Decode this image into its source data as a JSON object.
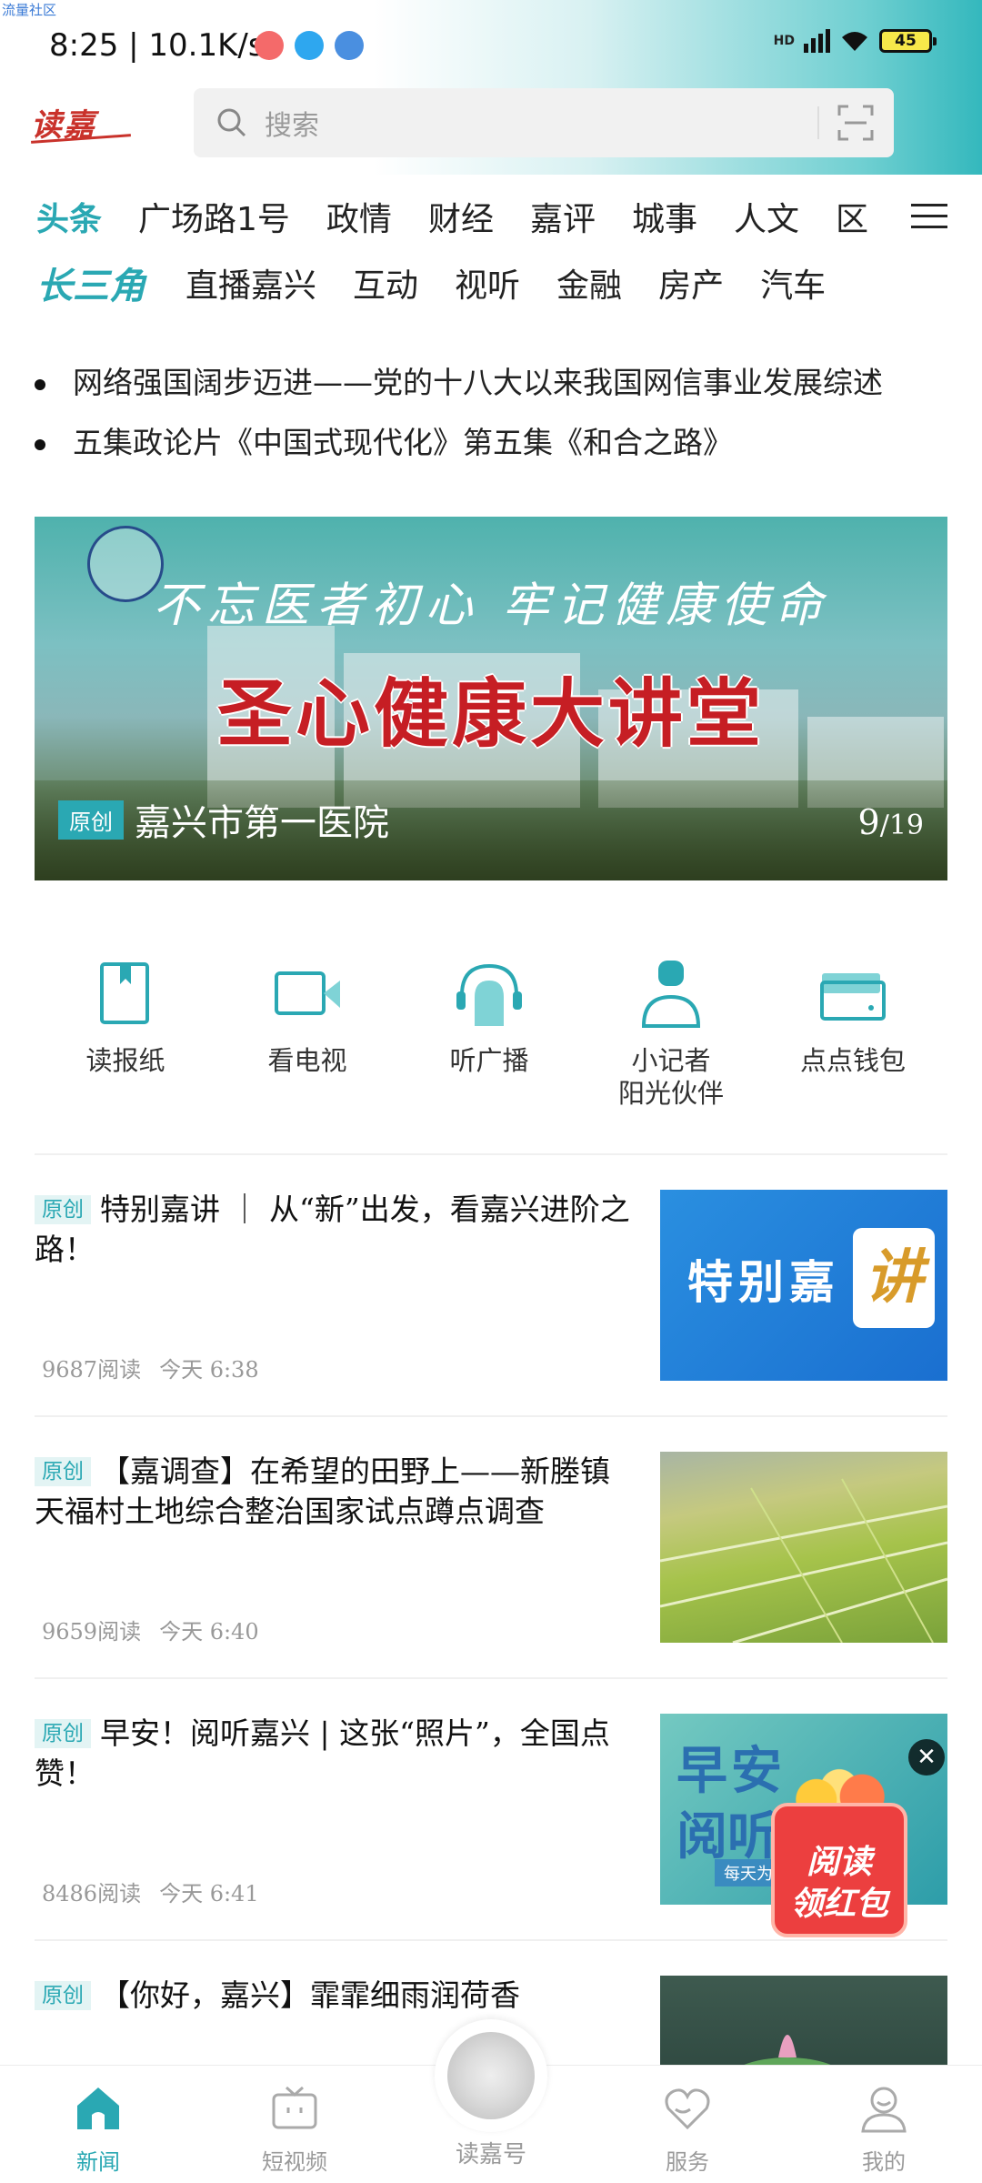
{
  "corner_label": "流量社区",
  "status_bar": {
    "time": "8:25 | 10.1K/s",
    "battery": "45",
    "hd": "HD"
  },
  "header": {
    "logo_text": "读嘉",
    "search_placeholder": "搜索"
  },
  "channels": {
    "row1": [
      "头条",
      "广场路1号",
      "政情",
      "财经",
      "嘉评",
      "城事",
      "人文",
      "区"
    ],
    "row2_brand": "长三角",
    "row2": [
      "直播嘉兴",
      "互动",
      "视听",
      "金融",
      "房产",
      "汽车"
    ]
  },
  "ticker": [
    "网络强国阔步迈进——党的十八大以来我国网信事业发展综述",
    "五集政论片《中国式现代化》第五集《和合之路》"
  ],
  "banner": {
    "slogan": "不忘医者初心  牢记健康使命",
    "headline": "圣心健康大讲堂",
    "tag": "原创",
    "caption": "嘉兴市第一医院",
    "page_current": "9",
    "page_total": "/19"
  },
  "quick_entries": [
    {
      "label": "读报纸",
      "icon": "newspaper-icon"
    },
    {
      "label": "看电视",
      "icon": "tv-camera-icon"
    },
    {
      "label": "听广播",
      "icon": "radio-headphone-icon"
    },
    {
      "label": "小记者\n阳光伙伴",
      "icon": "young-reporter-icon"
    },
    {
      "label": "点点钱包",
      "icon": "wallet-icon"
    }
  ],
  "news": [
    {
      "tag": "原创",
      "title": "特别嘉讲 ｜ 从“新”出发，看嘉兴进阶之路！",
      "reads": "9687阅读",
      "time": "今天  6:38",
      "thumb_text": "特别嘉",
      "thumb_big": "讲"
    },
    {
      "tag": "原创",
      "title": "【嘉调查】在希望的田野上——新塍镇天福村土地综合整治国家试点蹲点调查",
      "reads": "9659阅读",
      "time": "今天  6:40"
    },
    {
      "tag": "原创",
      "title": "早安！阅听嘉兴 | 这张“照片”，全国点赞！",
      "reads": "8486阅读",
      "time": "今天  6:41",
      "thumb_l1": "早安",
      "thumb_l2": "阅听",
      "thumb_l3": "每天为您"
    },
    {
      "tag": "原创",
      "title": "【你好，嘉兴】霏霏细雨润荷香",
      "reads": "",
      "time": ""
    }
  ],
  "red_packet": {
    "line1": "阅读",
    "line2": "领红包",
    "close": "✕"
  },
  "tabbar": {
    "items": [
      "新闻",
      "短视频",
      "读嘉号",
      "服务",
      "我的"
    ],
    "active": "新闻",
    "accent": "#2aa8b3"
  }
}
